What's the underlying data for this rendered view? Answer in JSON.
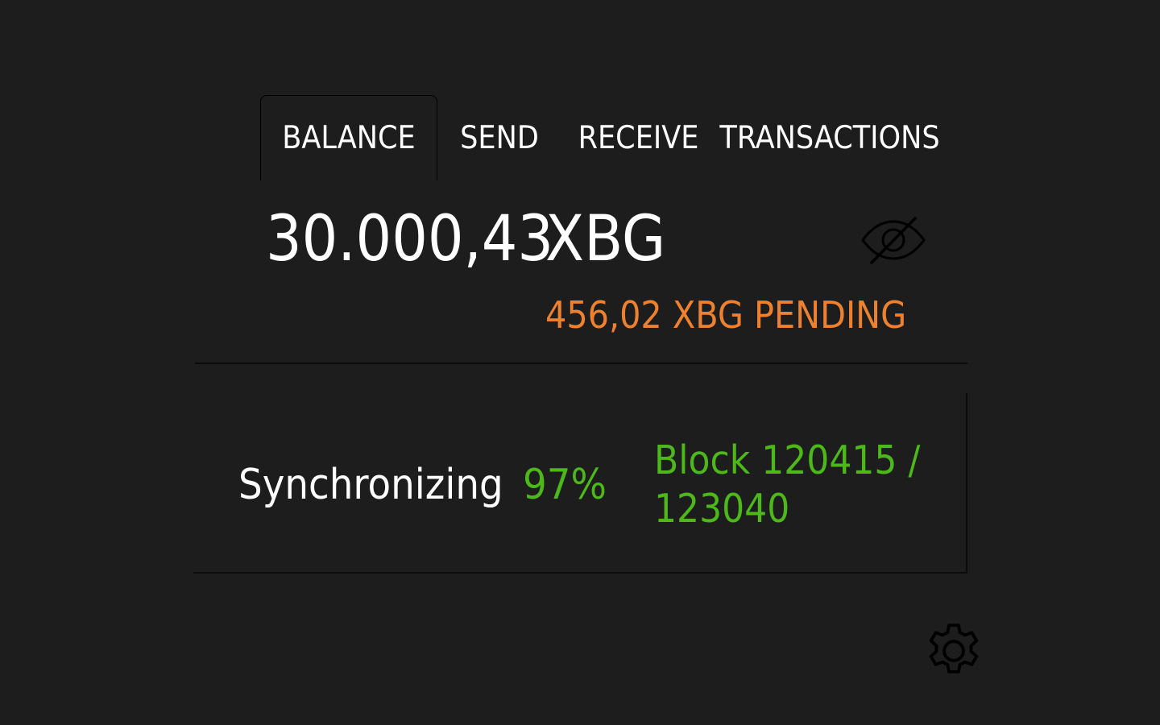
{
  "tabs": [
    {
      "label": "BALANCE",
      "active": true
    },
    {
      "label": "SEND",
      "active": false
    },
    {
      "label": "RECEIVE",
      "active": false
    },
    {
      "label": "TRANSACTIONS",
      "active": false
    }
  ],
  "balance": {
    "amount": "30.000,43",
    "currency": "XBG",
    "pending": "456,02 XBG PENDING",
    "visibility_icon": "eye-off-icon"
  },
  "sync": {
    "label": "Synchronizing",
    "percent": "97%",
    "progress": 0.97,
    "block_line1": "Block 120415 /",
    "block_line2": "123040"
  },
  "settings": {
    "icon": "gear-icon"
  },
  "colors": {
    "background": "#1d1d1d",
    "pending": "#ee8130",
    "sync": "#4cb81a",
    "text": "#ffffff"
  }
}
